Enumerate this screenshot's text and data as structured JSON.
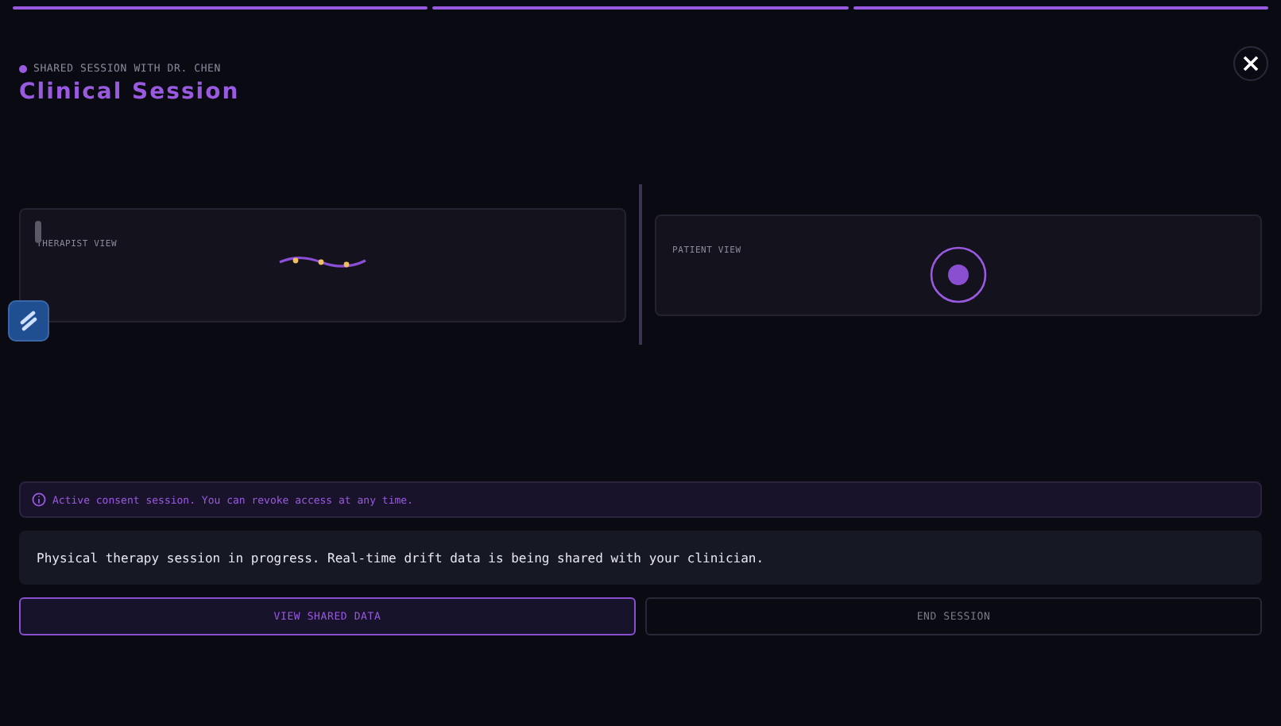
{
  "progress": [
    {
      "done": true
    },
    {
      "done": true
    },
    {
      "done": true
    }
  ],
  "header": {
    "label": "SHARED SESSION WITH DR. CHEN",
    "title": "Clinical Session",
    "live": true
  },
  "views": [
    {
      "kind": "wave",
      "label": "THERAPIST VIEW"
    },
    {
      "kind": "target",
      "label": "PATIENT VIEW"
    }
  ],
  "consent": "Active consent session. You can revoke access at any time.",
  "message": "Physical therapy session in progress. Real-time drift data is being shared with your clinician.",
  "buttons": [
    {
      "label": "VIEW SHARED DATA",
      "kind": "primary"
    },
    {
      "label": "END SESSION",
      "kind": "secondary"
    }
  ]
}
